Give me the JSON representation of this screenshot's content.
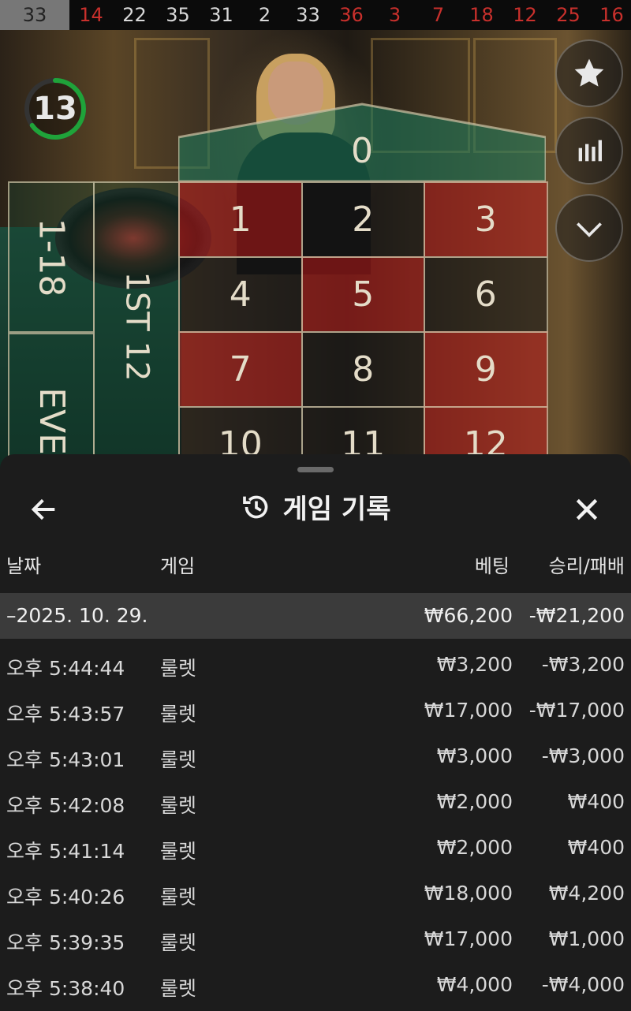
{
  "results": [
    {
      "n": "33",
      "c": "gray"
    },
    {
      "n": "14",
      "c": "red"
    },
    {
      "n": "22",
      "c": "black"
    },
    {
      "n": "35",
      "c": "black"
    },
    {
      "n": "31",
      "c": "black"
    },
    {
      "n": "2",
      "c": "black"
    },
    {
      "n": "33",
      "c": "black"
    },
    {
      "n": "36",
      "c": "red"
    },
    {
      "n": "3",
      "c": "red"
    },
    {
      "n": "7",
      "c": "red"
    },
    {
      "n": "18",
      "c": "red"
    },
    {
      "n": "12",
      "c": "red"
    },
    {
      "n": "25",
      "c": "red"
    },
    {
      "n": "16",
      "c": "red"
    }
  ],
  "timer": {
    "value": "13",
    "fraction": 0.65,
    "color": "#1fa33a"
  },
  "table": {
    "zero": "0",
    "numbers": [
      {
        "n": "1",
        "c": "red"
      },
      {
        "n": "2",
        "c": "black"
      },
      {
        "n": "3",
        "c": "red"
      },
      {
        "n": "4",
        "c": "black"
      },
      {
        "n": "5",
        "c": "red"
      },
      {
        "n": "6",
        "c": "black"
      },
      {
        "n": "7",
        "c": "red"
      },
      {
        "n": "8",
        "c": "black"
      },
      {
        "n": "9",
        "c": "red"
      },
      {
        "n": "10",
        "c": "black"
      },
      {
        "n": "11",
        "c": "black"
      },
      {
        "n": "12",
        "c": "red"
      }
    ],
    "low_label": "1-18",
    "even_label": "EVEN",
    "dozen_label": "1ST 12"
  },
  "side_buttons": [
    {
      "icon": "star-icon"
    },
    {
      "icon": "stats-icon"
    },
    {
      "icon": "chevron-down-icon"
    }
  ],
  "history": {
    "title": "게임 기록",
    "columns": {
      "date": "날짜",
      "game": "게임",
      "bet": "베팅",
      "result": "승리/패배"
    },
    "date_group": {
      "date": "–2025. 10. 29.",
      "bet": "₩66,200",
      "result": "-₩21,200"
    },
    "rows": [
      {
        "time": "오후 5:44:44",
        "game": "룰렛",
        "bet": "₩3,200",
        "result": "-₩3,200"
      },
      {
        "time": "오후 5:43:57",
        "game": "룰렛",
        "bet": "₩17,000",
        "result": "-₩17,000"
      },
      {
        "time": "오후 5:43:01",
        "game": "룰렛",
        "bet": "₩3,000",
        "result": "-₩3,000"
      },
      {
        "time": "오후 5:42:08",
        "game": "룰렛",
        "bet": "₩2,000",
        "result": "₩400"
      },
      {
        "time": "오후 5:41:14",
        "game": "룰렛",
        "bet": "₩2,000",
        "result": "₩400"
      },
      {
        "time": "오후 5:40:26",
        "game": "룰렛",
        "bet": "₩18,000",
        "result": "₩4,200"
      },
      {
        "time": "오후 5:39:35",
        "game": "룰렛",
        "bet": "₩17,000",
        "result": "₩1,000"
      },
      {
        "time": "오후 5:38:40",
        "game": "룰렛",
        "bet": "₩4,000",
        "result": "-₩4,000"
      }
    ]
  }
}
